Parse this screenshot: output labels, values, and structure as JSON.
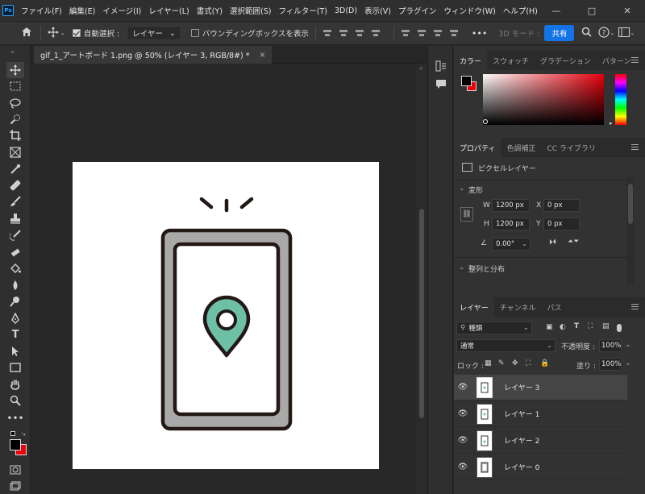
{
  "app": {
    "logo": "Ps",
    "menu": [
      "ファイル(F)",
      "編集(E)",
      "イメージ(I)",
      "レイヤー(L)",
      "書式(Y)",
      "選択範囲(S)",
      "フィルター(T)",
      "3D(D)",
      "表示(V)",
      "プラグイン",
      "ウィンドウ(W)",
      "ヘルプ(H)"
    ],
    "window_controls": [
      "—",
      "□",
      "✕"
    ]
  },
  "options": {
    "auto_select_label": "自動選択 :",
    "auto_select_target": "レイヤー",
    "bounding_box_label": "バウンディングボックスを表示",
    "more": "•••",
    "mode_3d": "3D モード :",
    "share_label": "共有"
  },
  "document": {
    "tab_title": "gif_1_アートボード 1.png @ 50% (レイヤー 3, RGB/8#) *",
    "tab_close": "×"
  },
  "color_panel": {
    "tabs": [
      "カラー",
      "スウォッチ",
      "グラデーション",
      "パターン"
    ],
    "foreground": "#000000",
    "background": "#e8000d"
  },
  "properties_panel": {
    "tabs": [
      "プロパティ",
      "色調補正",
      "CC ライブラリ"
    ],
    "kind": "ピクセルレイヤー",
    "transform_section": "変形",
    "w_label": "W",
    "w_value": "1200 px",
    "h_label": "H",
    "h_value": "1200 px",
    "x_label": "X",
    "x_value": "0 px",
    "y_label": "Y",
    "y_value": "0 px",
    "angle_value": "0.00°",
    "align_section": "整列と分布"
  },
  "layers_panel": {
    "tabs": [
      "レイヤー",
      "チャンネル",
      "パス"
    ],
    "filter_kind": "種類",
    "blend_mode": "通常",
    "opacity_label": "不透明度 :",
    "opacity_value": "100%",
    "lock_label": "ロック :",
    "fill_label": "塗り :",
    "fill_value": "100%",
    "layers": [
      {
        "name": "レイヤー 3",
        "selected": true
      },
      {
        "name": "レイヤー 1",
        "selected": false
      },
      {
        "name": "レイヤー 2",
        "selected": false
      },
      {
        "name": "レイヤー 0",
        "selected": false
      }
    ]
  },
  "illustration": {
    "phone_frame": "#a9a9a9",
    "outline": "#231815",
    "pin": "#6dbfa6"
  }
}
